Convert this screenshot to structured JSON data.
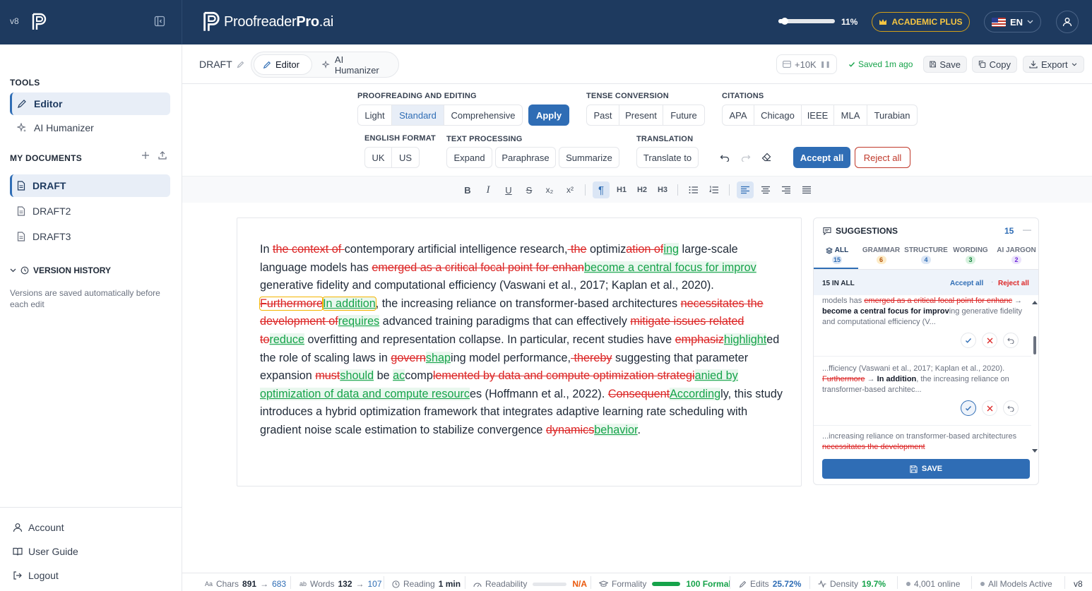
{
  "app": {
    "version": "v8",
    "brand_regular": "Proofreader",
    "brand_bold": "Pro",
    "brand_suffix": ".ai",
    "usage_percent": 11,
    "usage_label": "11%",
    "plan_label": "ACADEMIC PLUS",
    "language": "EN"
  },
  "sidebar": {
    "tools_title": "TOOLS",
    "tools": [
      {
        "label": "Editor",
        "icon": "pencil-icon",
        "active": true
      },
      {
        "label": "AI Humanizer",
        "icon": "sparkle-icon",
        "active": false
      }
    ],
    "documents_title": "MY DOCUMENTS",
    "documents": [
      {
        "label": "DRAFT",
        "active": true
      },
      {
        "label": "DRAFT2",
        "active": false
      },
      {
        "label": "DRAFT3",
        "active": false
      }
    ],
    "version_history_title": "VERSION HISTORY",
    "version_history_note": "Versions are saved automatically before each edit",
    "footer": [
      {
        "label": "Account",
        "icon": "user-icon"
      },
      {
        "label": "User Guide",
        "icon": "book-icon"
      },
      {
        "label": "Logout",
        "icon": "logout-icon"
      }
    ]
  },
  "header": {
    "doc_name": "DRAFT",
    "tabs": [
      {
        "label": "Editor",
        "active": true
      },
      {
        "label": "AI Humanizer",
        "active": false
      }
    ],
    "limit_label": "+10K",
    "saved_label": "Saved 1m ago",
    "save_label": "Save",
    "copy_label": "Copy",
    "export_label": "Export"
  },
  "toolbar": {
    "proofreading": {
      "title": "PROOFREADING AND EDITING",
      "options": [
        "Light",
        "Standard",
        "Comprehensive"
      ],
      "selected": "Standard",
      "apply_label": "Apply"
    },
    "tense": {
      "title": "TENSE CONVERSION",
      "options": [
        "Past",
        "Present",
        "Future"
      ]
    },
    "citations": {
      "title": "CITATIONS",
      "options": [
        "APA",
        "Chicago",
        "IEEE",
        "MLA",
        "Turabian"
      ]
    },
    "english": {
      "title": "ENGLISH FORMAT",
      "options": [
        "UK",
        "US"
      ]
    },
    "text_processing": {
      "title": "TEXT PROCESSING",
      "options": [
        "Expand",
        "Paraphrase",
        "Summarize"
      ]
    },
    "translation": {
      "title": "TRANSLATION",
      "button": "Translate to"
    },
    "accept_all": "Accept all",
    "reject_all": "Reject all",
    "format_buttons": {
      "h1": "H1",
      "h2": "H2",
      "h3": "H3",
      "sub": "x₂",
      "sup": "x²"
    }
  },
  "editor": {
    "segments": [
      {
        "t": "n",
        "v": "In "
      },
      {
        "t": "d",
        "v": "the context of "
      },
      {
        "t": "n",
        "v": "contemporary artificial intelligence research,"
      },
      {
        "t": "d",
        "v": " the"
      },
      {
        "t": "n",
        "v": " optimiz"
      },
      {
        "t": "d",
        "v": "ation of"
      },
      {
        "t": "i",
        "v": "ing"
      },
      {
        "t": "n",
        "v": " large-scale language models has "
      },
      {
        "t": "d",
        "v": "emerged as a critical focal point for enhan"
      },
      {
        "t": "i",
        "v": "become a central focus for improv"
      },
      {
        "t": "n",
        "v": " generative fidelity and computational efficiency (Vaswani et al., 2017; Kaplan et al., 2020). "
      },
      {
        "t": "db",
        "v": "Furthermore"
      },
      {
        "t": "ib",
        "v": "In addition"
      },
      {
        "t": "n",
        "v": ", the increasing reliance on transformer-based architectures "
      },
      {
        "t": "d",
        "v": "necessitates the development of"
      },
      {
        "t": "i",
        "v": "requires"
      },
      {
        "t": "n",
        "v": " advanced training paradigms that can effectively "
      },
      {
        "t": "d",
        "v": "mitigate issues related to"
      },
      {
        "t": "i",
        "v": "reduce"
      },
      {
        "t": "n",
        "v": " overfitting and representation collapse. In particular, recent studies have "
      },
      {
        "t": "d",
        "v": "emphasiz"
      },
      {
        "t": "i",
        "v": "highlight"
      },
      {
        "t": "n",
        "v": "ed the role of scaling laws in "
      },
      {
        "t": "d",
        "v": "govern"
      },
      {
        "t": "i",
        "v": "shap"
      },
      {
        "t": "n",
        "v": "ing model performance,"
      },
      {
        "t": "d",
        "v": " thereby"
      },
      {
        "t": "n",
        "v": " suggesting that parameter expansion "
      },
      {
        "t": "d",
        "v": "must"
      },
      {
        "t": "i",
        "v": "should"
      },
      {
        "t": "n",
        "v": " be "
      },
      {
        "t": "i",
        "v": "ac"
      },
      {
        "t": "n",
        "v": "comp"
      },
      {
        "t": "d",
        "v": "lemented by data and compute optimization strategi"
      },
      {
        "t": "i",
        "v": "anied by optimization of data and compute resourc"
      },
      {
        "t": "n",
        "v": "es (Hoffmann et al., 2022). "
      },
      {
        "t": "d",
        "v": "Consequent"
      },
      {
        "t": "i",
        "v": "According"
      },
      {
        "t": "n",
        "v": "ly, this study introduces a hybrid optimization framework that integrates adaptive learning rate scheduling with gradient noise scale estimation to stabilize convergence "
      },
      {
        "t": "d",
        "v": "dynamics"
      },
      {
        "t": "i",
        "v": "behavior"
      },
      {
        "t": "n",
        "v": "."
      }
    ]
  },
  "suggestions": {
    "title": "SUGGESTIONS",
    "count": "15",
    "tabs": [
      {
        "label": "ALL",
        "count": "15",
        "color": "#2f6db5"
      },
      {
        "label": "GRAMMAR",
        "count": "6",
        "color": "#d97706"
      },
      {
        "label": "STRUCTURE",
        "count": "4",
        "color": "#2f6db5"
      },
      {
        "label": "WORDING",
        "count": "3",
        "color": "#16a34a"
      },
      {
        "label": "AI JARGON",
        "count": "2",
        "color": "#7c3aed"
      }
    ],
    "in_all_label": "15 IN ALL",
    "accept_all": "Accept all",
    "reject_all": "Reject all",
    "items": [
      {
        "before": "models has ",
        "del": "emerged as a critical focal point for enhanc",
        "ins": "become a central focus for improv",
        "after": "ing generative fidelity and computational efficiency (V..."
      },
      {
        "before": "...fficiency (Vaswani et al., 2017; Kaplan et al., 2020). ",
        "del": "Furthermore",
        "ins": "In addition",
        "after": ", the increasing reliance on transformer-based architec..."
      },
      {
        "before": "...increasing reliance on transformer-based architectures ",
        "del": "necessitates the development",
        "ins": "",
        "after": ""
      }
    ],
    "save_label": "SAVE"
  },
  "status": {
    "chars_label": "Chars",
    "chars_from": "891",
    "chars_to": "683",
    "words_label": "Words",
    "words_from": "132",
    "words_to": "107",
    "reading_label": "Reading",
    "reading_value": "1 min",
    "readability_label": "Readability",
    "readability_value": "N/A",
    "formality_label": "Formality",
    "formality_value": "100 Formal",
    "formality_level": 100,
    "edits_label": "Edits",
    "edits_value": "25.72%",
    "density_label": "Density",
    "density_value": "19.7%",
    "online_label": "4,001 online",
    "models_label": "All Models Active",
    "version": "v8"
  },
  "colors": {
    "topbar": "#1e3a5f",
    "accent": "#2f6db5",
    "deletion": "#dc2626",
    "insertion": "#16a34a",
    "plan": "#f5c542"
  }
}
